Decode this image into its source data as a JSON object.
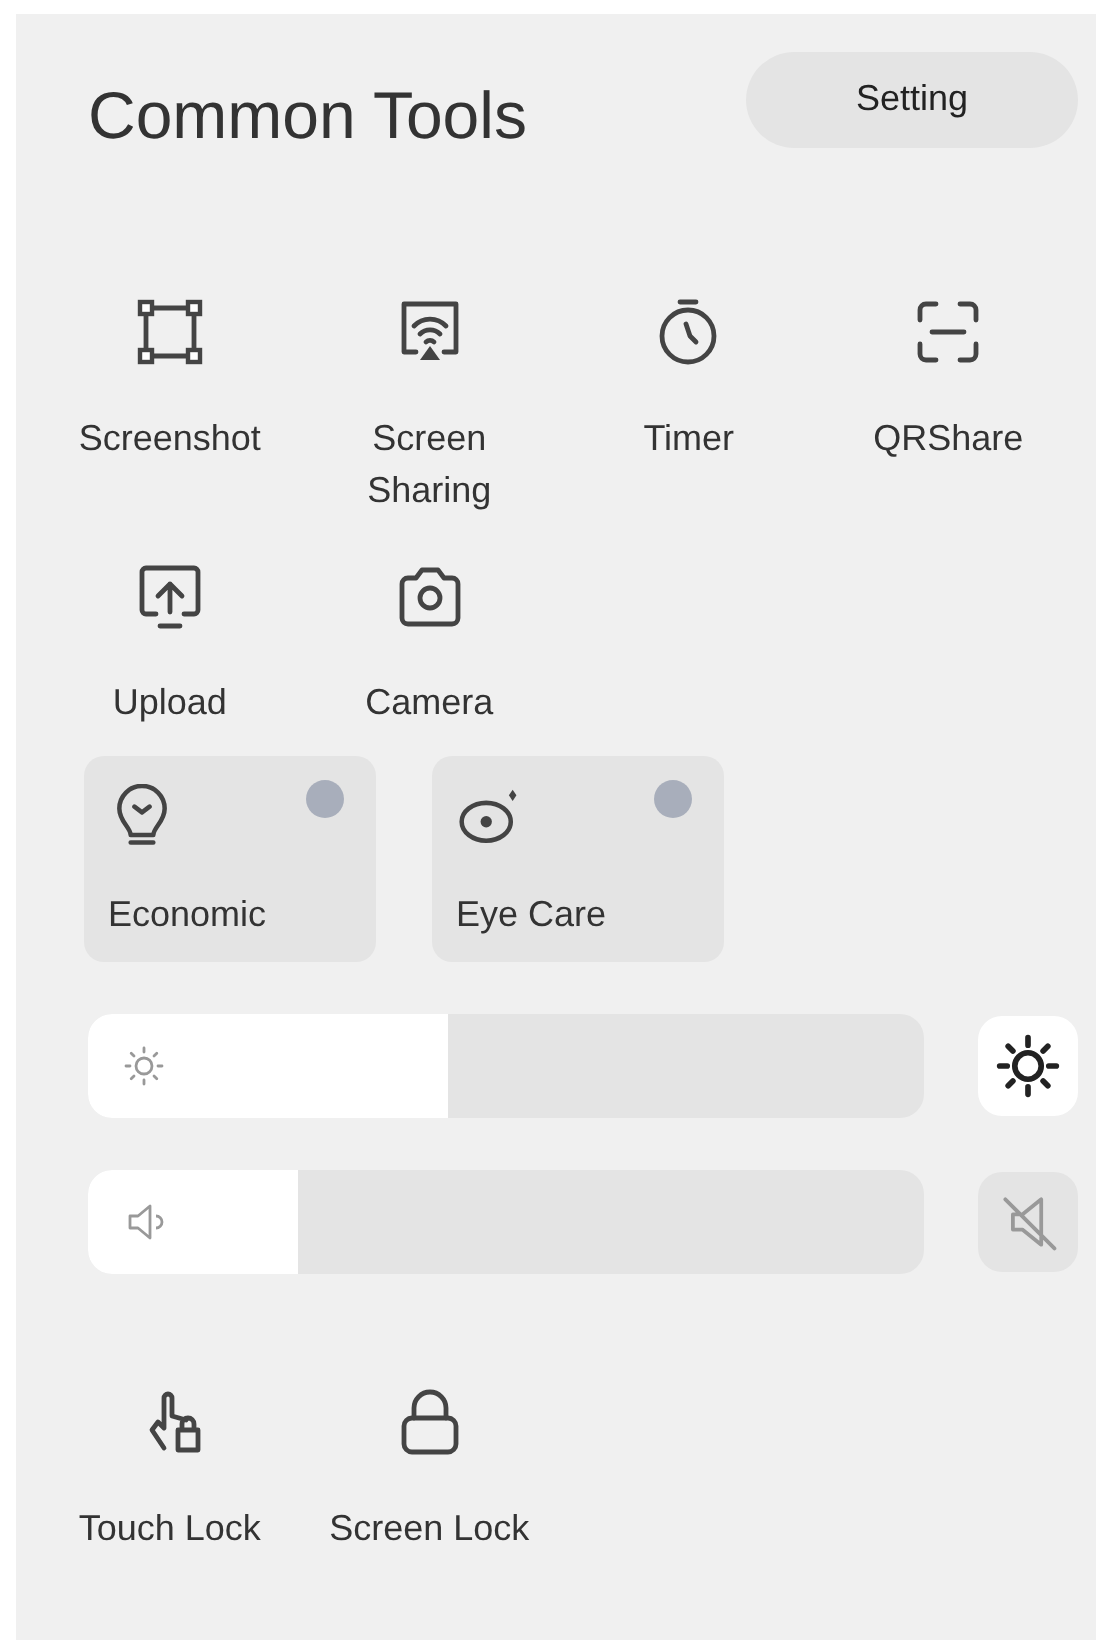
{
  "title": "Common Tools",
  "setting_button": "Setting",
  "tools": [
    {
      "label": "Screenshot",
      "kind": "frame"
    },
    {
      "label": "Screen Sharing",
      "kind": "cast"
    },
    {
      "label": "Timer",
      "kind": "timer"
    },
    {
      "label": "QRShare",
      "kind": "scan"
    },
    {
      "label": "Upload",
      "kind": "upload"
    },
    {
      "label": "Camera",
      "kind": "camera"
    }
  ],
  "toggles": [
    {
      "label": "Economic",
      "kind": "bulb",
      "on": false
    },
    {
      "label": "Eye Care",
      "kind": "eye",
      "on": false
    }
  ],
  "sliders": [
    {
      "kind": "brightness",
      "level": 0.43,
      "button_on": true
    },
    {
      "kind": "volume",
      "level": 0.25,
      "button_on": false
    }
  ],
  "locks": [
    {
      "label": "Touch Lock",
      "kind": "touchlock"
    },
    {
      "label": "Screen Lock",
      "kind": "lock"
    }
  ]
}
